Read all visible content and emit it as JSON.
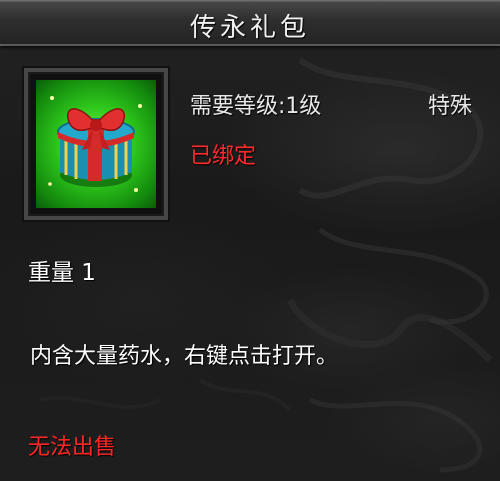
{
  "item": {
    "name": "传永礼包",
    "level_requirement": "需要等级:1级",
    "category": "特殊",
    "bind_status": "已绑定",
    "weight": "重量 1",
    "description": "内含大量药水，右键点击打开。",
    "sell_status": "无法出售",
    "icon": "gift-box-icon"
  },
  "colors": {
    "normal_text": "#e8e8e8",
    "warning_text": "#ff2b2b",
    "icon_glow": "#2dc41b"
  }
}
